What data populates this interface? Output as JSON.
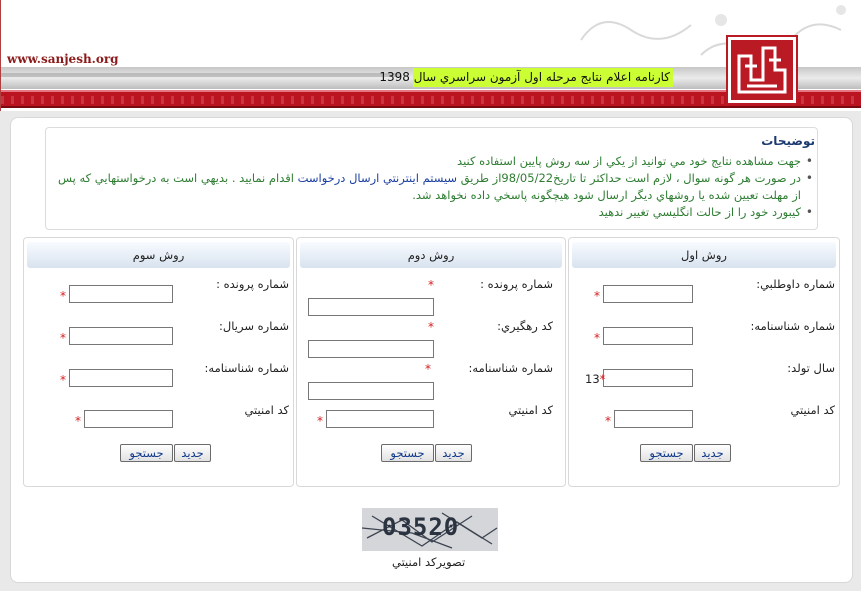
{
  "header": {
    "site_url": "www.sanjesh.org",
    "title": "كارنامه اعلام نتايج مرحله اول آزمون سراسري سال 1398"
  },
  "notes": {
    "title": "توضيحات",
    "items": [
      "جهت مشاهده نتايج خود مي توانيد از يكي از سه روش پايين استفاده كنيد",
      "در صورت هر گونه سوال ، لازم است حداكثر تا تاريخ98/05/22از طريق ",
      "سيستم اينترنتي ارسال درخواست",
      " اقدام نماييد . بديهي است به درخواستهايي كه پس از مهلت تعيين شده يا روشهاي ديگر ارسال شود هيچگونه پاسخي داده نخواهد شد.",
      "كيبورد خود را از حالت انگليسي تغيير ندهيد"
    ]
  },
  "method1": {
    "title": "روش اول",
    "voluntary_label": "شماره داوطلبي:",
    "national_label": "شماره شناسنامه:",
    "birth_label": "سال تولد:",
    "birth_prefix": "13",
    "security_label": "كد امنيتي",
    "search_button": "جستجو",
    "new_button": "جديد"
  },
  "method2": {
    "title": "روش دوم",
    "file_label": "شماره پرونده :",
    "tracking_label": "كد رهگيري:",
    "national_label": "شماره شناسنامه:",
    "security_label": "كد امنيتي",
    "search_button": "جستجو",
    "new_button": "جديد"
  },
  "method3": {
    "title": "روش سوم",
    "file_label": "شماره پرونده :",
    "serial_label": "شماره سريال:",
    "national_label": "شماره شناسنامه:",
    "security_label": "كد امنيتي",
    "search_button": "جستجو",
    "new_button": "جديد"
  },
  "captcha": {
    "code": "03520",
    "caption": "تصويركد امنيتي"
  },
  "required_marker": "*",
  "colors": {
    "brand_red": "#b9141f",
    "title_highlight": "#ccff33",
    "notes_green": "#2e7d32",
    "link_blue": "#1a3fa0"
  }
}
